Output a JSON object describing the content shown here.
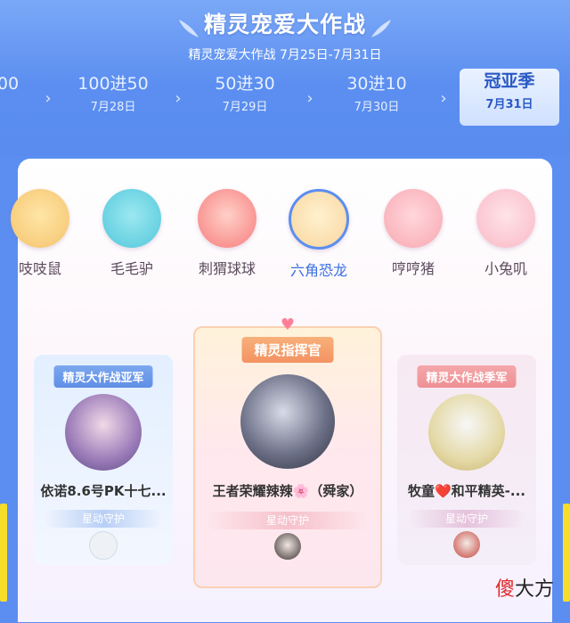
{
  "header": {
    "title": "精灵宠爱大作战",
    "subtitle": "精灵宠爱大作战  7月25日-7月31日"
  },
  "stages": [
    {
      "name": "00",
      "date": ""
    },
    {
      "name": "100进50",
      "date": "7月28日"
    },
    {
      "name": "50进30",
      "date": "7月29日"
    },
    {
      "name": "30进10",
      "date": "7月30日"
    },
    {
      "name": "冠亚季",
      "date": "7月31日"
    }
  ],
  "active_stage": "冠亚季",
  "sprites": [
    {
      "name": "吱吱鼠",
      "color": "#f4c36c",
      "icon": "mouse-icon"
    },
    {
      "name": "毛毛驴",
      "color": "#53c7da",
      "icon": "donkey-icon"
    },
    {
      "name": "刺猬球球",
      "color": "#f77c7c",
      "icon": "hedgehog-icon"
    },
    {
      "name": "六角恐龙",
      "color": "#f9d59e",
      "icon": "axolotl-icon"
    },
    {
      "name": "哼哼猪",
      "color": "#f8a7b0",
      "icon": "pig-icon"
    },
    {
      "name": "小兔叽",
      "color": "#f9b9c6",
      "icon": "rabbit-icon"
    }
  ],
  "selected_sprite": "六角恐龙",
  "cards": {
    "left": {
      "ribbon": "精灵大作战亚军",
      "player": "依诺8.6号PK十七...",
      "guard": "星动守护"
    },
    "center": {
      "ribbon": "精灵指挥官",
      "player": "王者荣耀辣辣🌸（舜家）",
      "guard": "星动守护"
    },
    "right": {
      "ribbon": "精灵大作战季军",
      "player": "牧童❤️和平精英-...",
      "guard": "星动守护"
    }
  },
  "watermark": {
    "red": "傻",
    "rest": "大方"
  },
  "colors": {
    "background": "#5b8ef0",
    "accent": "#3b6fe0",
    "side_bar": "#f6dd2a"
  }
}
